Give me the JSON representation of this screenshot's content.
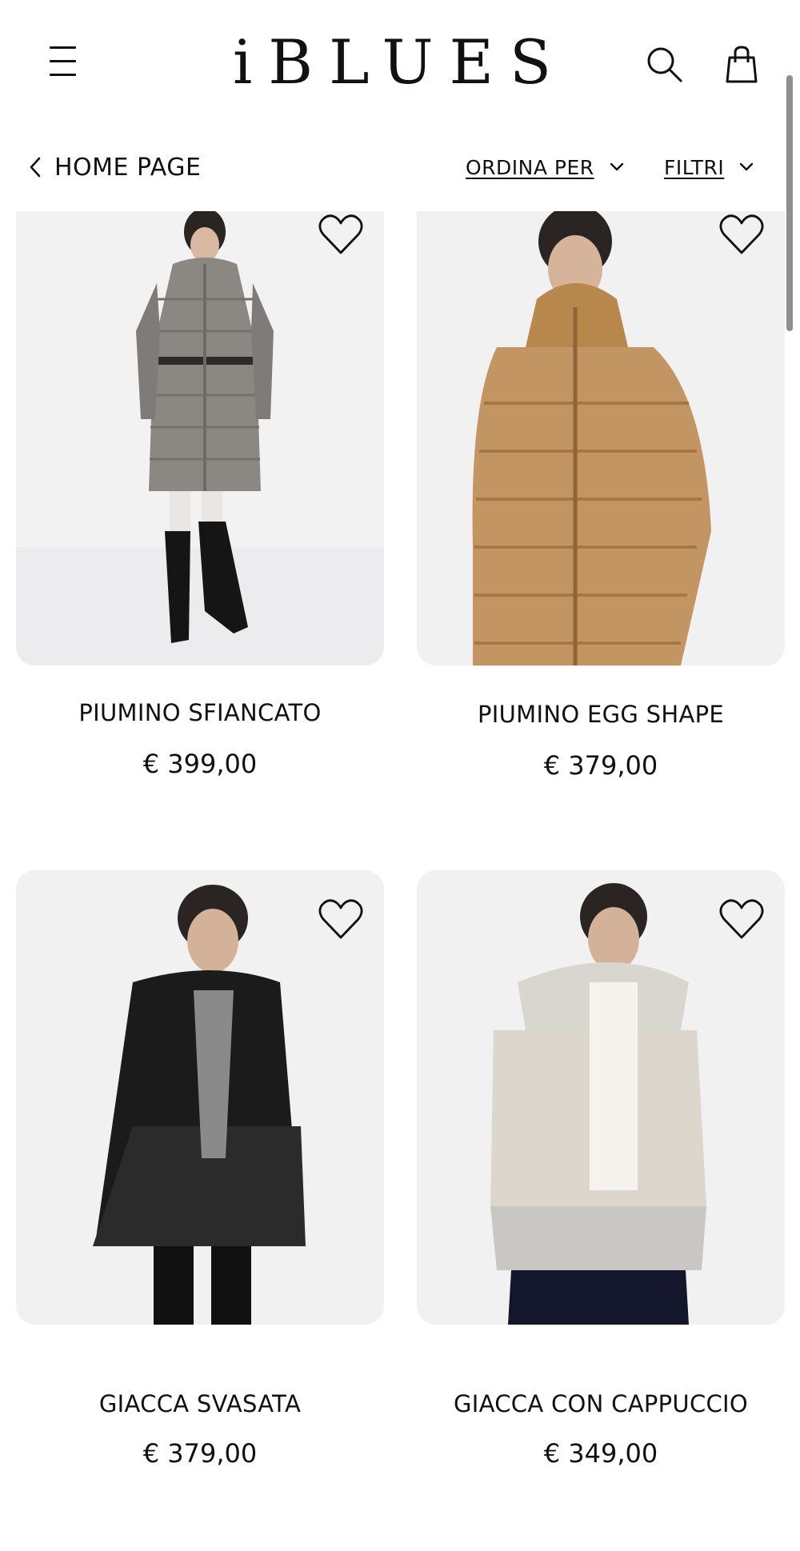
{
  "header": {
    "brand": "iBLUES",
    "icons": [
      "menu-icon",
      "search-icon",
      "shopping-bag-icon"
    ]
  },
  "toolbar": {
    "back_label": "HOME PAGE",
    "sort_label": "ORDINA PER",
    "filter_label": "FILTRI"
  },
  "products": [
    {
      "name": "PIUMINO SFIANCATO",
      "price": "€ 399,00"
    },
    {
      "name": "PIUMINO EGG SHAPE",
      "price": "€ 379,00"
    },
    {
      "name": "GIACCA SVASATA",
      "price": "€ 379,00"
    },
    {
      "name": "GIACCA CON CAPPUCCIO",
      "price": "€ 349,00"
    }
  ],
  "colors": {
    "text": "#111111",
    "background": "#ffffff",
    "image_background": "#f1f1f2"
  }
}
